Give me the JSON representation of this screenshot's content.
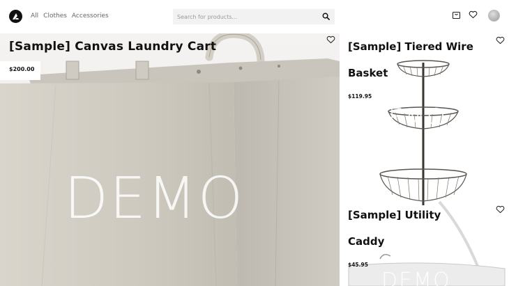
{
  "header": {
    "nav": [
      "All",
      "Clothes",
      "Accessories"
    ],
    "search_placeholder": "Search for products..."
  },
  "products": [
    {
      "title": "[Sample] Canvas Laundry Cart",
      "price": "$200.00",
      "watermark": "DEMO"
    },
    {
      "title_line1": "[Sample] Tiered Wire",
      "title_line2": "Basket",
      "price": "$119.95",
      "watermark": "DEMO"
    },
    {
      "title_line1": "[Sample] Utility",
      "title_line2": "Caddy",
      "price": "$45.95",
      "watermark": "DEMO"
    }
  ]
}
